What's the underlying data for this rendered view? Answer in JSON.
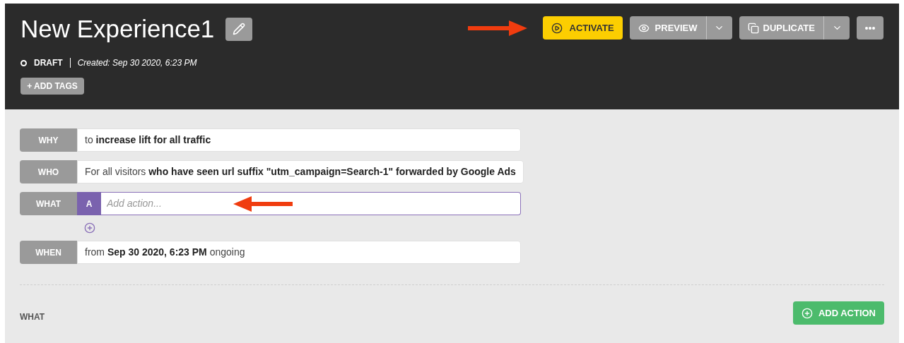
{
  "header": {
    "title": "New Experience1",
    "status": "DRAFT",
    "created": "Created: Sep 30 2020, 6:23 PM",
    "add_tags": "+ ADD TAGS",
    "buttons": {
      "activate": "ACTIVATE",
      "preview": "PREVIEW",
      "duplicate": "DUPLICATE"
    }
  },
  "rows": [
    {
      "kind": "text",
      "label": "WHY",
      "text": "to **increase lift for all traffic**"
    },
    {
      "kind": "text",
      "label": "WHO",
      "text": "For all visitors **who have seen url suffix \"utm_campaign=Search-1\" forwarded by Google Ads**"
    },
    {
      "kind": "action",
      "label": "WHAT",
      "badge": "A",
      "placeholder": "Add action..."
    },
    {
      "kind": "text",
      "label": "WHEN",
      "text": "from **Sep 30 2020, 6:23 PM** ongoing"
    }
  ],
  "footer": {
    "section": "WHAT",
    "add_action": "ADD ACTION"
  }
}
